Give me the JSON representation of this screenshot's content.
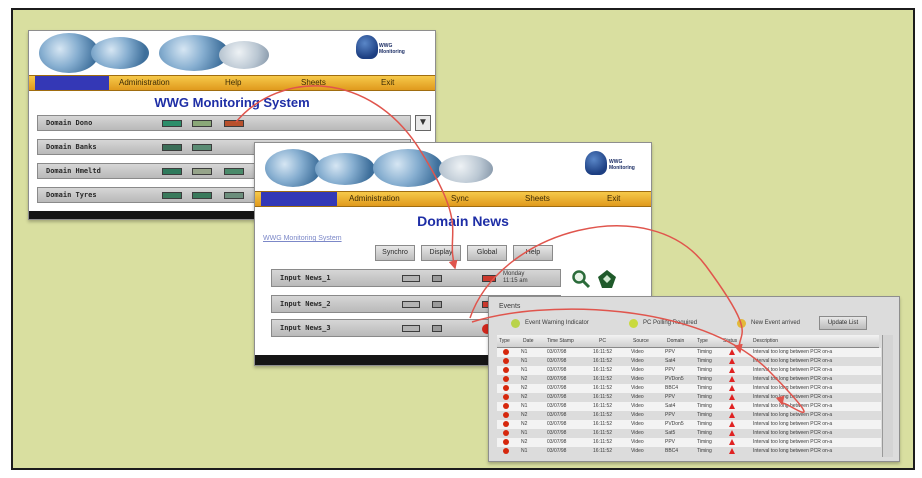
{
  "window1": {
    "menu": [
      "",
      "Administration",
      "Help",
      "Sheets",
      "Exit"
    ],
    "title": "WWG Monitoring System",
    "rows": [
      "Domain Dono",
      "Domain Banks",
      "Domain Hmeltd",
      "Domain Tyres"
    ],
    "logo_text": "WWG Monitoring"
  },
  "window2": {
    "menu": [
      "",
      "Administration",
      "Sync",
      "Sheets",
      "Exit"
    ],
    "title": "Domain News",
    "breadcrumb_link": "WWG Monitoring System",
    "tabs": [
      "Synchro",
      "Display",
      "Global",
      "Help"
    ],
    "rows": [
      "Input News_1",
      "Input News_2",
      "Input News_3"
    ],
    "timestamp": "Monday 11:15 am",
    "logo_text": "WWG Monitoring"
  },
  "window3": {
    "header": "Events",
    "legend": [
      "Event Warning Indicator",
      "PC Polling Required",
      "New Event arrived"
    ],
    "legend_colors": [
      "#b9d34a",
      "#c9da3e",
      "#e2b93a"
    ],
    "update_button": "Update List",
    "columns": [
      "Type",
      "Date",
      "Time Stamp",
      "PC",
      "Source",
      "Domain",
      "Type",
      "Status",
      "Description"
    ],
    "rows": [
      [
        "!",
        "N1",
        "03/07/98",
        "16:11:52",
        "Video",
        "PPV",
        "Timing",
        "Interval too long between PCR on-a"
      ],
      [
        "!",
        "N1",
        "03/07/98",
        "16:11:52",
        "Video",
        "Sat4",
        "Timing",
        "Interval too long between PCR on-a"
      ],
      [
        "!",
        "N1",
        "03/07/98",
        "16:11:52",
        "Video",
        "PPV",
        "Timing",
        "Interval too long between PCR on-a"
      ],
      [
        "!",
        "N2",
        "03/07/98",
        "16:11:52",
        "Video",
        "PVDon5",
        "Timing",
        "Interval too long between PCR on-a"
      ],
      [
        "!",
        "N2",
        "03/07/98",
        "16:11:52",
        "Video",
        "BBC4",
        "Timing",
        "Interval too long between PCR on-a"
      ],
      [
        "!",
        "N2",
        "03/07/98",
        "16:11:52",
        "Video",
        "PPV",
        "Timing",
        "Interval too long between PCR on-a"
      ],
      [
        "!",
        "N1",
        "03/07/98",
        "16:11:52",
        "Video",
        "Sat4",
        "Timing",
        "Interval too long between PCR on-a"
      ],
      [
        "!",
        "N2",
        "03/07/98",
        "16:11:52",
        "Video",
        "PPV",
        "Timing",
        "Interval too long between PCR on-a"
      ],
      [
        "!",
        "N2",
        "03/07/98",
        "16:11:52",
        "Video",
        "PVDon5",
        "Timing",
        "Interval too long between PCR on-a"
      ],
      [
        "!",
        "N1",
        "03/07/98",
        "16:11:52",
        "Video",
        "Sat5",
        "Timing",
        "Interval too long between PCR on-a"
      ],
      [
        "!",
        "N2",
        "03/07/98",
        "16:11:52",
        "Video",
        "PPV",
        "Timing",
        "Interval too long between PCR on-a"
      ],
      [
        "!",
        "N1",
        "03/07/98",
        "16:11:52",
        "Video",
        "BBC4",
        "Timing",
        "Interval too long between PCR on-a"
      ]
    ]
  },
  "colors": {
    "background": "#d9dfa0",
    "menu_bar": "#e8a92a",
    "title_blue": "#1e2ea6",
    "arrow_red": "#e0554d"
  },
  "icons": [
    "magnify-icon",
    "tools-icon",
    "globe-icon",
    "wwg-logo-icon"
  ]
}
